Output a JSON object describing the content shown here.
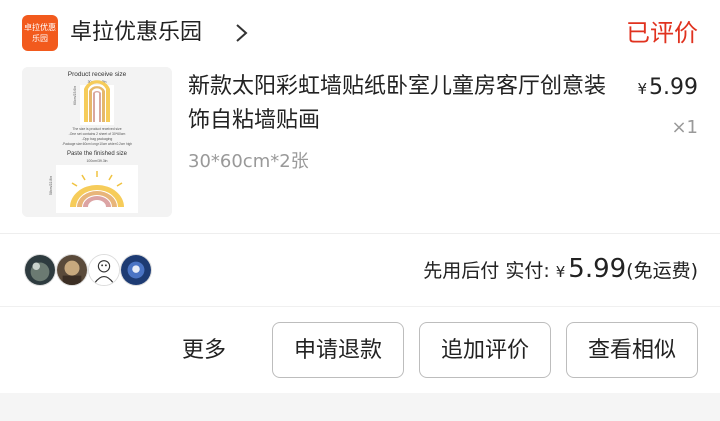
{
  "shop": {
    "logo_line1": "卓拉优惠",
    "logo_line2": "乐园",
    "name": "卓拉优惠乐园",
    "chevron_icon": "chevron-right-icon"
  },
  "order": {
    "status": "已评价",
    "title": "新款太阳彩虹墙贴纸卧室儿童房客厅创意装饰自粘墙贴画",
    "spec": "30*60cm*2张",
    "price_symbol": "¥",
    "price": "5.99",
    "quantity": "×1"
  },
  "thumbnail": {
    "heading": "Product receive size",
    "size_top": "30cm/11.8in",
    "size_side": "60cm/23.6in",
    "note1": "The size is product received size",
    "note2": "-One set contains 2 sheet of 30*60cm",
    "note3": "-Opp bag packaging",
    "note4": "-Package size:60cm long×10cm wide×0.2cm high",
    "heading2": "Paste the finished size",
    "size_bottom": "100cm/39.3in",
    "size_side2": "58cm/22.8in"
  },
  "payment": {
    "method": "先用后付",
    "label": "实付:",
    "symbol": "¥",
    "amount": "5.99",
    "shipping": "(免运费)"
  },
  "actions": {
    "more": "更多",
    "refund": "申请退款",
    "add_review": "追加评价",
    "similar": "查看相似"
  },
  "colors": {
    "accent": "#e0321f",
    "logo": "#f25a1d"
  }
}
